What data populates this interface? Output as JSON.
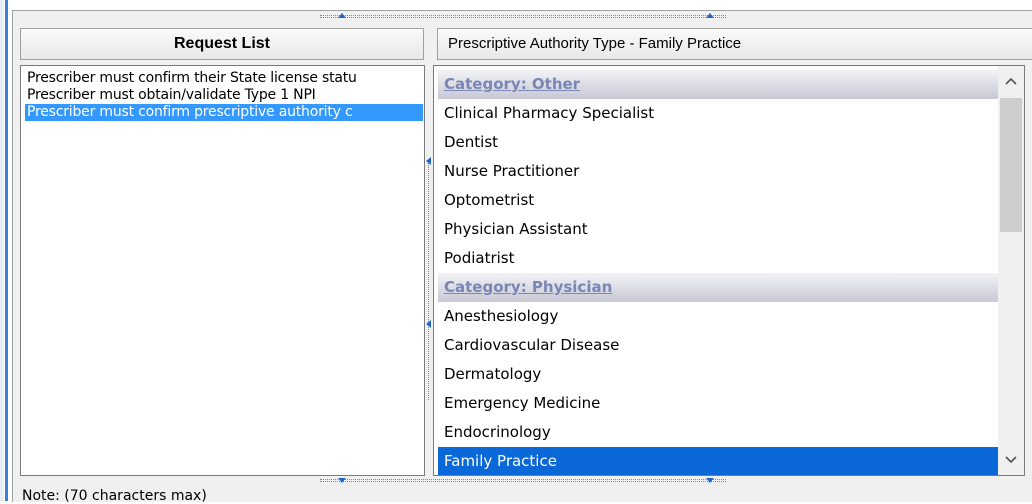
{
  "request_list": {
    "header": "Request List",
    "items": [
      {
        "label": "Prescriber must confirm their State license statu",
        "selected": false
      },
      {
        "label": "Prescriber must obtain/validate Type 1 NPI",
        "selected": false
      },
      {
        "label": "Prescriber must confirm prescriptive authority c",
        "selected": true
      }
    ]
  },
  "authority_panel": {
    "header": "Prescriptive Authority Type - Family Practice",
    "rows": [
      {
        "label": "Category: Other",
        "type": "category"
      },
      {
        "label": "Clinical Pharmacy Specialist",
        "type": "item"
      },
      {
        "label": "Dentist",
        "type": "item"
      },
      {
        "label": "Nurse Practitioner",
        "type": "item"
      },
      {
        "label": "Optometrist",
        "type": "item"
      },
      {
        "label": "Physician Assistant",
        "type": "item"
      },
      {
        "label": "Podiatrist",
        "type": "item"
      },
      {
        "label": "Category: Physician",
        "type": "category"
      },
      {
        "label": "Anesthesiology",
        "type": "item"
      },
      {
        "label": "Cardiovascular Disease",
        "type": "item"
      },
      {
        "label": "Dermatology",
        "type": "item"
      },
      {
        "label": "Emergency Medicine",
        "type": "item"
      },
      {
        "label": "Endocrinology",
        "type": "item"
      },
      {
        "label": "Family Practice",
        "type": "item",
        "selected": true
      }
    ],
    "scrollbar": {
      "up_icon": "chevron-up-icon",
      "down_icon": "chevron-down-icon"
    }
  },
  "note": {
    "label": "Note: (70 characters max)"
  },
  "colors": {
    "selection": "#3399ff",
    "selected_row": "#0a68d8",
    "category_text": "#7a86b4",
    "splitter_accent": "#2466c4"
  }
}
